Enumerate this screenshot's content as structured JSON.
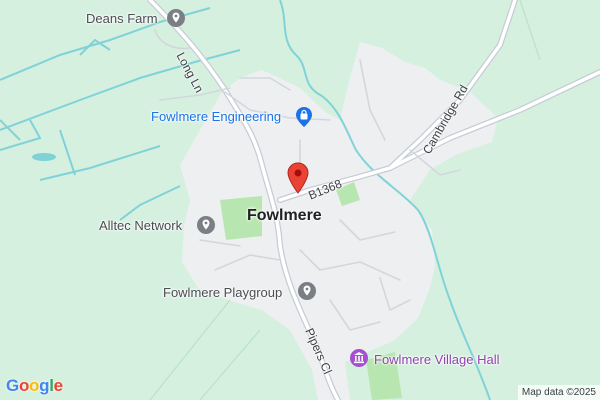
{
  "map": {
    "place_labels": {
      "town": "Fowlmere",
      "deans_farm": "Deans Farm",
      "engineering": "Fowlmere Engineering",
      "alltec": "Alltec Network",
      "playgroup": "Fowlmere Playgroup",
      "village_hall": "Fowlmere Village Hall"
    },
    "road_labels": {
      "long_ln": "Long Ln",
      "b1368": "B1368",
      "cambridge_rd": "Cambridge Rd",
      "pipers_cl": "Pipers Cl"
    },
    "attribution": "Map data ©2025",
    "logo_letters": [
      "G",
      "o",
      "o",
      "g",
      "l",
      "e"
    ],
    "colors": {
      "background": "#d6f0e0",
      "town_area": "#eeeff1",
      "water": "#7fd3d8",
      "road": "#ffffff",
      "road_outline": "#c6ccd4",
      "park": "#b8e6b0",
      "marker": "#ea4335",
      "poi_gray": "#7a7f86",
      "poi_blue": "#1a73e8",
      "poi_purple": "#a64fd1",
      "logo": [
        "#4285f4",
        "#ea4335",
        "#fbbc05",
        "#4285f4",
        "#34a853",
        "#ea4335"
      ]
    },
    "icons": {
      "deans_farm": "location-circle-icon",
      "engineering": "shopping-bag-icon",
      "alltec": "location-circle-icon",
      "playgroup": "location-circle-icon",
      "village_hall": "landmark-icon",
      "marker": "map-pin-icon"
    }
  }
}
